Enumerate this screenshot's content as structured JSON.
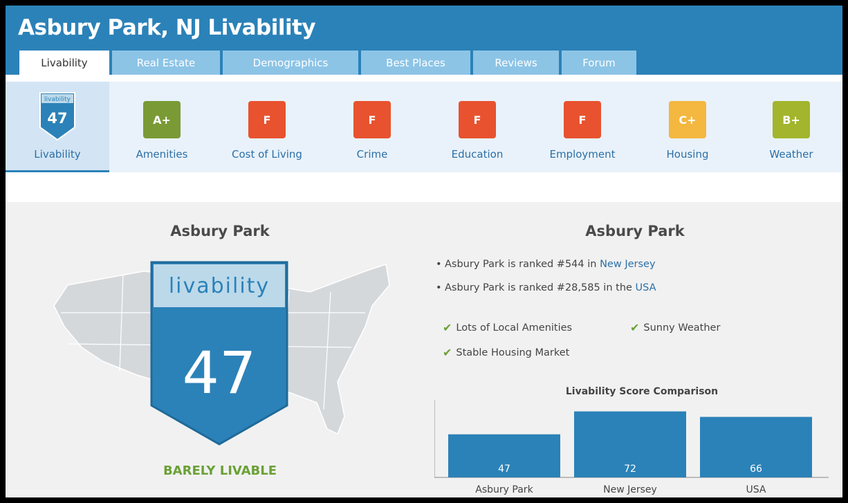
{
  "header": {
    "title": "Asbury Park, NJ Livability",
    "tabs": [
      {
        "label": "Livability",
        "active": true
      },
      {
        "label": "Real Estate"
      },
      {
        "label": "Demographics"
      },
      {
        "label": "Best Places"
      },
      {
        "label": "Reviews"
      },
      {
        "label": "Forum"
      }
    ]
  },
  "categories": [
    {
      "label": "Livability",
      "badge_word": "livability",
      "score": "47",
      "active": true
    },
    {
      "label": "Amenities",
      "grade": "A+",
      "color": "#7a9a35"
    },
    {
      "label": "Cost of Living",
      "grade": "F",
      "color": "#e8522f"
    },
    {
      "label": "Crime",
      "grade": "F",
      "color": "#e8522f"
    },
    {
      "label": "Education",
      "grade": "F",
      "color": "#e8522f"
    },
    {
      "label": "Employment",
      "grade": "F",
      "color": "#e8522f"
    },
    {
      "label": "Housing",
      "grade": "C+",
      "color": "#f4b740"
    },
    {
      "label": "Weather",
      "grade": "B+",
      "color": "#a3b52c"
    }
  ],
  "left": {
    "title": "Asbury Park",
    "badge_word": "livability",
    "score": "47",
    "verdict": "BARELY LIVABLE"
  },
  "right": {
    "title": "Asbury Park",
    "rank_state": {
      "prefix": "Asbury Park is ranked #544 in ",
      "link": "New Jersey"
    },
    "rank_usa": {
      "prefix": "Asbury Park is ranked #28,585 in the ",
      "link": "USA"
    },
    "features": [
      "Lots of Local Amenities",
      "Sunny Weather",
      "Stable Housing Market"
    ]
  },
  "chart_data": {
    "type": "bar",
    "title": "Livability Score Comparison",
    "categories": [
      "Asbury Park",
      "New Jersey",
      "USA"
    ],
    "values": [
      47,
      72,
      66
    ],
    "ylim": [
      0,
      80
    ],
    "color": "#2b82b8"
  },
  "colors": {
    "brand": "#2b82b8",
    "tab_inactive": "#8cc4e6",
    "good": "#6aa136",
    "fail": "#e8522f"
  }
}
